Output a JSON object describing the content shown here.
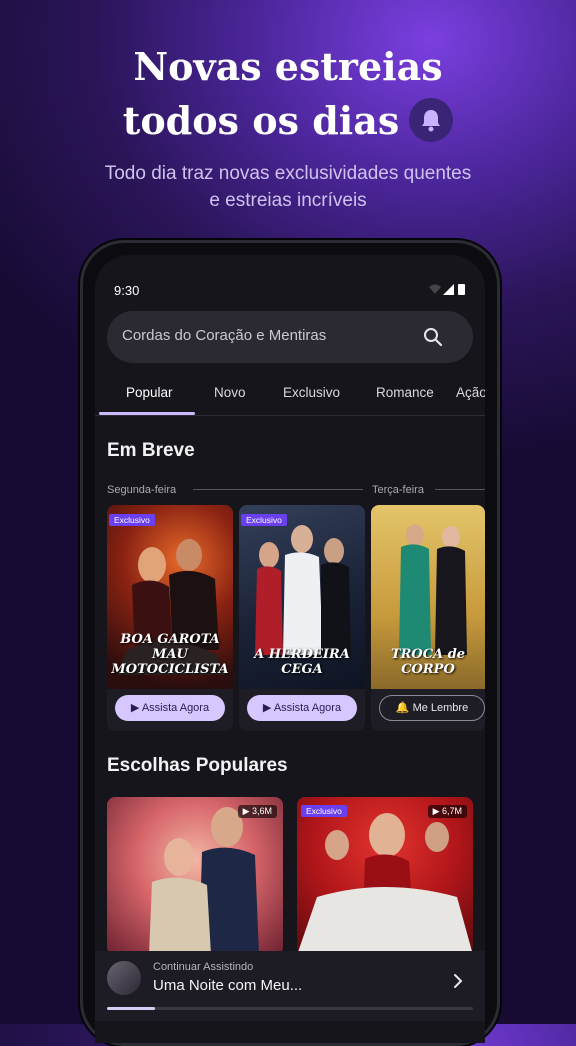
{
  "hero": {
    "title_line1": "Novas estreias",
    "title_line2": "todos os dias",
    "subtitle_line1": "Todo dia traz novas exclusividades quentes",
    "subtitle_line2": "e estreias incríveis"
  },
  "status_bar": {
    "time": "9:30"
  },
  "search": {
    "placeholder": "Cordas do Coração e Mentiras"
  },
  "tabs": [
    {
      "label": "Popular",
      "active": true
    },
    {
      "label": "Novo"
    },
    {
      "label": "Exclusivo"
    },
    {
      "label": "Romance"
    },
    {
      "label": "Ação"
    }
  ],
  "coming_soon": {
    "title": "Em Breve",
    "days": [
      "Segunda-feira",
      "Terça-feira"
    ],
    "cards": [
      {
        "badge": "Exclusivo",
        "poster_title": "BOA GAROTA MAU MOTOCICLISTA",
        "button": "Assista Agora"
      },
      {
        "badge": "Exclusivo",
        "poster_title": "A HERDEIRA CEGA",
        "button": "Assista Agora"
      },
      {
        "poster_title": "TROCA de CORPO",
        "button": "Me Lembre"
      }
    ]
  },
  "popular_picks": {
    "title": "Escolhas Populares",
    "cards": [
      {
        "views": "3,6M"
      },
      {
        "badge": "Exclusivo",
        "views": "6,7M"
      }
    ]
  },
  "continue_watching": {
    "label": "Continuar Assistindo",
    "title": "Uma Noite com Meu...",
    "progress": 0.13
  },
  "colors": {
    "accent": "#6a3ff0",
    "button_bg": "#d6c8ff",
    "background": "#15151b"
  }
}
